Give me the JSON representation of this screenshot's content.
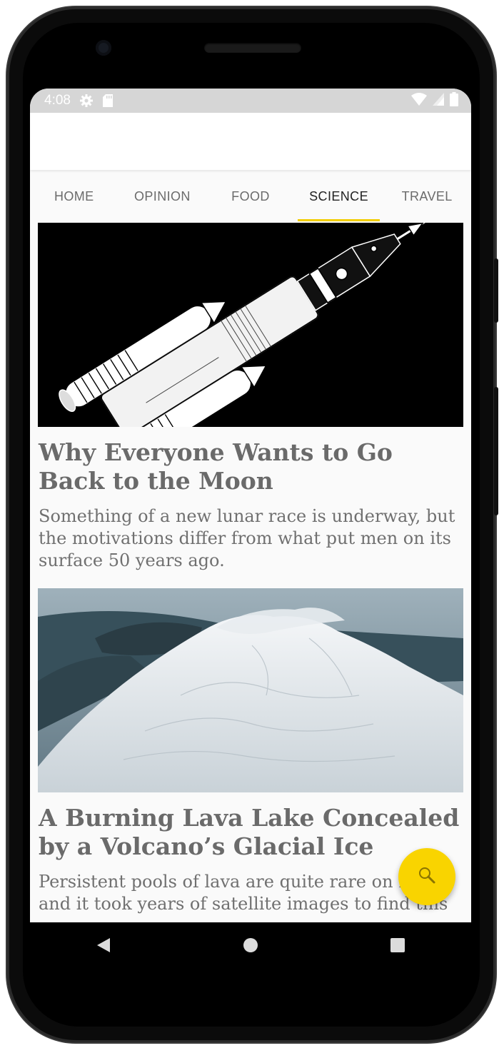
{
  "statusbar": {
    "time": "4:08"
  },
  "tabs": [
    {
      "label": "HOME"
    },
    {
      "label": "OPINION"
    },
    {
      "label": "FOOD"
    },
    {
      "label": "SCIENCE"
    },
    {
      "label": "TRAVEL"
    }
  ],
  "active_tab": "SCIENCE",
  "articles": [
    {
      "title": "Why Everyone Wants to Go Back to the Moon",
      "description": "Something of a new lunar race is underway, but the motivations differ from what put men on its surface 50 years ago."
    },
    {
      "title": "A Burning Lava Lake Concealed by a Volcano’s Glacial Ice",
      "description": "Persistent pools of lava are quite rare on Earth, and it took years of satellite images to find this one."
    }
  ],
  "colors": {
    "accent": "#f2cd00",
    "fab": "#f9d400",
    "status_bar": "#d6d6d6"
  },
  "icons": [
    "gear-icon",
    "sd-card-icon",
    "wifi-icon",
    "signal-icon",
    "battery-icon",
    "search-icon",
    "back-icon",
    "home-icon",
    "recents-icon"
  ]
}
